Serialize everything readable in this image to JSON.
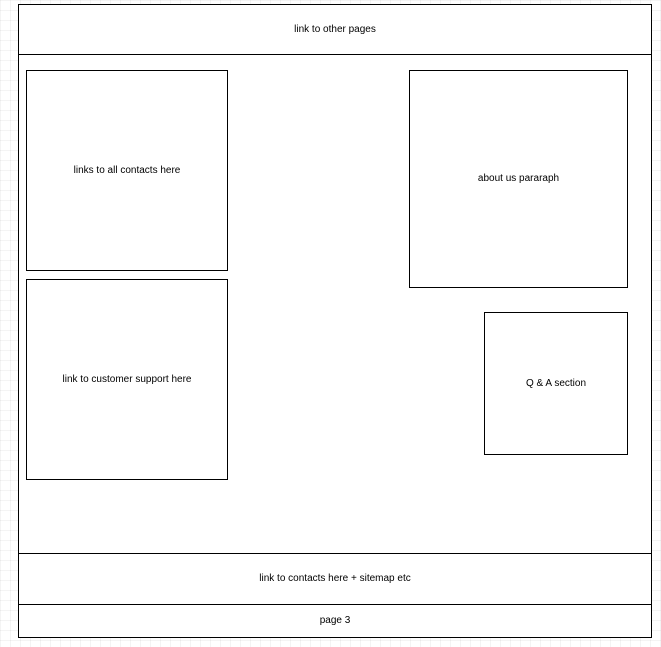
{
  "wireframe": {
    "header": {
      "label": "link to other pages"
    },
    "contacts_box": {
      "label": "links to all contacts here"
    },
    "support_box": {
      "label": "link to customer support here"
    },
    "about_box": {
      "label": "about us pararaph"
    },
    "qa_box": {
      "label": "Q & A section"
    },
    "footer": {
      "label": "link to contacts here + sitemap etc"
    },
    "page_number": {
      "label": "page 3"
    }
  }
}
